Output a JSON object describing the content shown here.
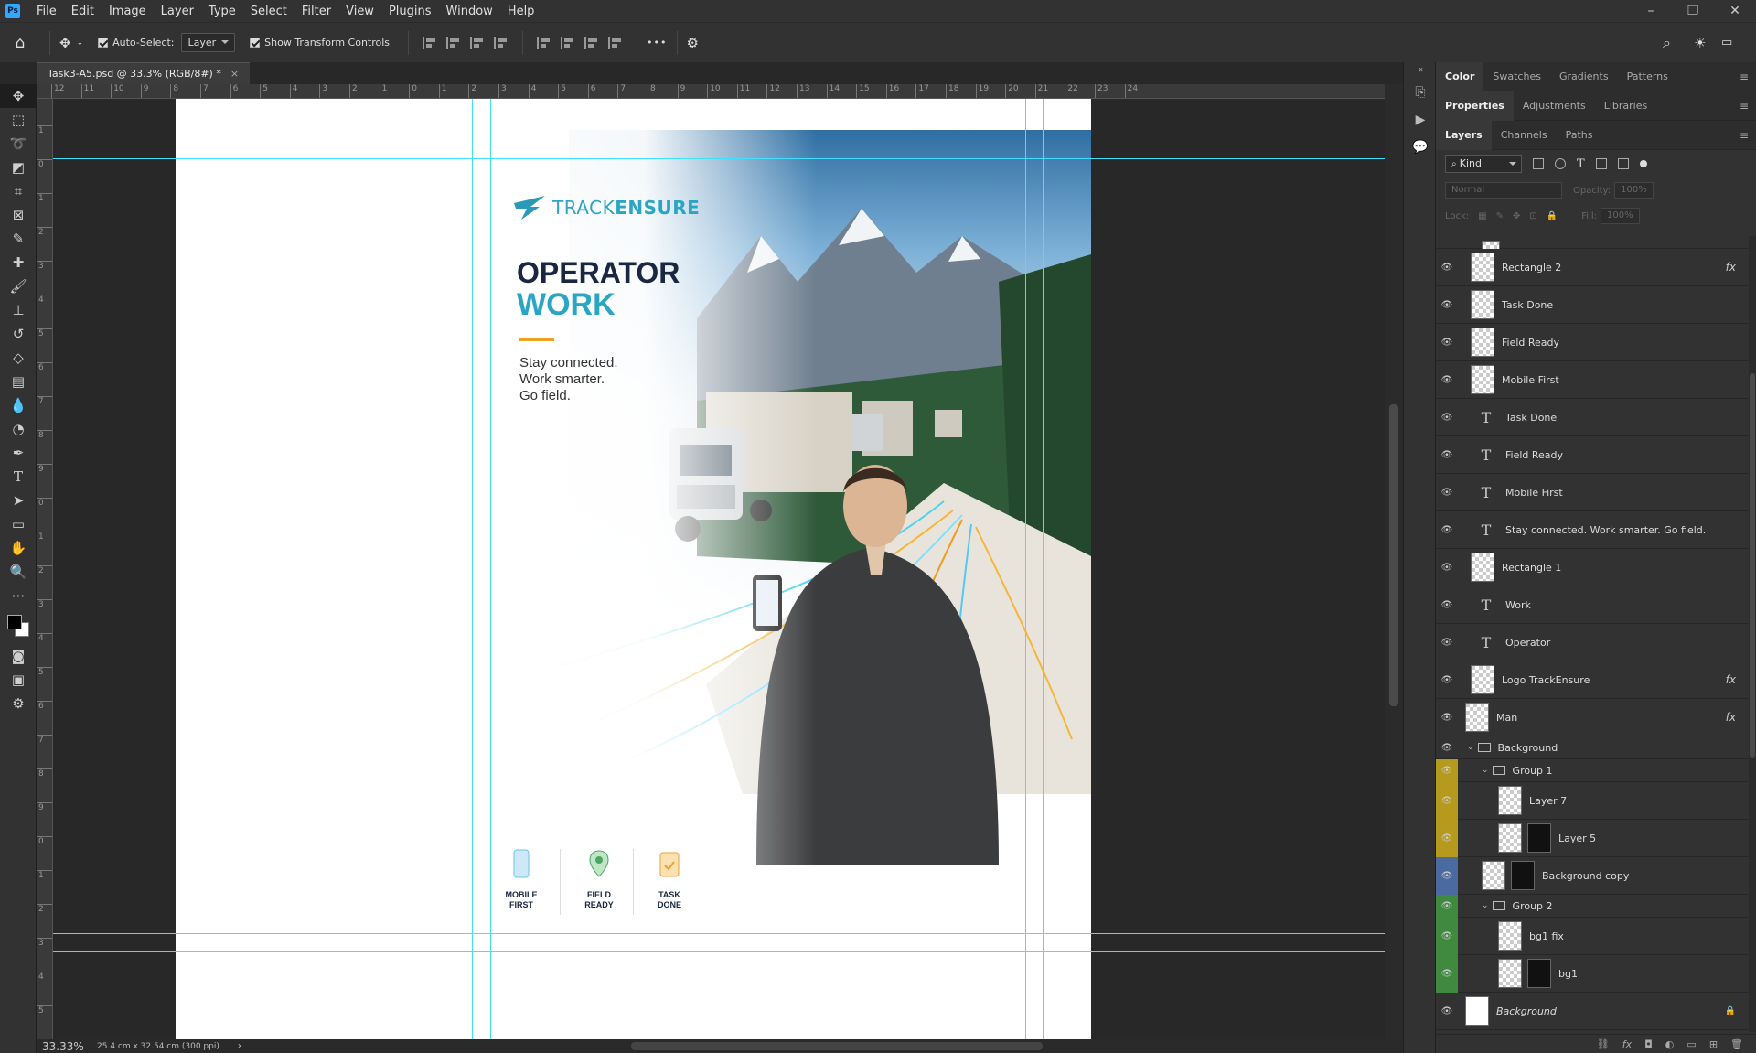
{
  "app": {
    "logo": "Ps"
  },
  "menu": [
    "File",
    "Edit",
    "Image",
    "Layer",
    "Type",
    "Select",
    "Filter",
    "View",
    "Plugins",
    "Window",
    "Help"
  ],
  "window_controls": {
    "minimize": "–",
    "restore": "❐",
    "close": "✕"
  },
  "options_bar": {
    "auto_select_label": "Auto-Select:",
    "auto_select_target": "Layer",
    "show_transform_label": "Show Transform Controls",
    "more": "•••"
  },
  "document_tab": {
    "title": "Task3-A5.psd @ 33.3% (RGB/8#) *",
    "close": "×"
  },
  "rulers": {
    "top": [
      "12",
      "11",
      "10",
      "9",
      "8",
      "7",
      "6",
      "5",
      "4",
      "3",
      "2",
      "1",
      "0",
      "1",
      "2",
      "3",
      "4",
      "5",
      "6",
      "7",
      "8",
      "9",
      "10",
      "11",
      "12",
      "13",
      "14",
      "15",
      "16",
      "17",
      "18",
      "19",
      "20",
      "21",
      "22",
      "23",
      "24"
    ],
    "left": [
      "2",
      "1",
      "0",
      "1",
      "2",
      "3",
      "4",
      "5",
      "6",
      "7",
      "8",
      "9",
      "0",
      "1",
      "2",
      "3",
      "4",
      "5",
      "6",
      "7",
      "8",
      "9",
      "0",
      "1",
      "2",
      "3",
      "4",
      "5"
    ]
  },
  "poster": {
    "logo_text_light": "TRACK",
    "logo_text_bold": "ENSURE",
    "title_line1": "OPERATOR",
    "title_line2": "WORK",
    "tagline": [
      "Stay connected.",
      "Work smarter.",
      "Go field."
    ],
    "features": [
      {
        "icon": "mobile-icon",
        "label1": "MOBILE",
        "label2": "FIRST"
      },
      {
        "icon": "location-pin-icon",
        "label1": "FIELD",
        "label2": "READY"
      },
      {
        "icon": "clipboard-check-icon",
        "label1": "TASK",
        "label2": "DONE"
      }
    ],
    "colors": {
      "navy": "#1a2742",
      "teal": "#2aa6c4",
      "accent": "#f0a020"
    }
  },
  "status_bar": {
    "zoom": "33.33%",
    "doc_info": "25.4 cm x 32.54 cm (300 ppi)"
  },
  "panels": {
    "top_tabs": [
      "Color",
      "Swatches",
      "Gradients",
      "Patterns"
    ],
    "mid_tabs": [
      "Properties",
      "Adjustments",
      "Libraries"
    ],
    "layer_tabs": [
      "Layers",
      "Channels",
      "Paths"
    ],
    "filter_kind": "Kind",
    "blend_mode": "Normal",
    "opacity_label": "Opacity:",
    "opacity_value": "100%",
    "lock_label": "Lock:",
    "fill_label": "Fill:",
    "fill_value": "100%"
  },
  "layers": [
    {
      "name": "Rectangle 2",
      "type": "smart",
      "fx": "fx",
      "eye": "none"
    },
    {
      "name": "Task Done",
      "type": "smart",
      "fx": "",
      "eye": "none"
    },
    {
      "name": "Field Ready",
      "type": "smart",
      "fx": "",
      "eye": "none"
    },
    {
      "name": "Mobile First",
      "type": "smart",
      "fx": "",
      "eye": "none"
    },
    {
      "name": "Task Done",
      "type": "text",
      "fx": "",
      "eye": "none"
    },
    {
      "name": "Field Ready",
      "type": "text",
      "fx": "",
      "eye": "none"
    },
    {
      "name": "Mobile First",
      "type": "text",
      "fx": "",
      "eye": "none"
    },
    {
      "name": "Stay connected.  Work smarter. Go field.",
      "type": "text",
      "fx": "",
      "eye": "none"
    },
    {
      "name": "Rectangle 1",
      "type": "smart",
      "fx": "",
      "eye": "none"
    },
    {
      "name": "Work",
      "type": "text",
      "fx": "",
      "eye": "none"
    },
    {
      "name": "Operator",
      "type": "text",
      "fx": "",
      "eye": "none"
    },
    {
      "name": "Logo TrackEnsure",
      "type": "smart",
      "fx": "fx",
      "eye": "none"
    },
    {
      "name": "Man",
      "type": "smart",
      "fx": "fx",
      "eye": "none"
    },
    {
      "name": "Background",
      "type": "group",
      "fx": "",
      "eye": "none"
    },
    {
      "name": "Group 1",
      "type": "group",
      "fx": "",
      "eye": "#b59a1d"
    },
    {
      "name": "Layer 7",
      "type": "pixel",
      "fx": "",
      "eye": "#b59a1d"
    },
    {
      "name": "Layer 5",
      "type": "masked",
      "fx": "",
      "eye": "#b59a1d"
    },
    {
      "name": "Background copy",
      "type": "masked",
      "fx": "",
      "eye": "#4a6aa0"
    },
    {
      "name": "Group 2",
      "type": "group",
      "fx": "",
      "eye": "#3f8a3f"
    },
    {
      "name": "bg1 fix",
      "type": "pixel",
      "fx": "",
      "eye": "#3f8a3f"
    },
    {
      "name": "bg1",
      "type": "masked",
      "fx": "",
      "eye": "#3f8a3f"
    },
    {
      "name": "Background",
      "type": "background",
      "fx": "",
      "eye": "none"
    }
  ],
  "layer_footer_icons": [
    "link-icon",
    "fx-icon",
    "mask-icon",
    "adjustment-icon",
    "folder-icon",
    "new-layer-icon",
    "trash-icon"
  ]
}
